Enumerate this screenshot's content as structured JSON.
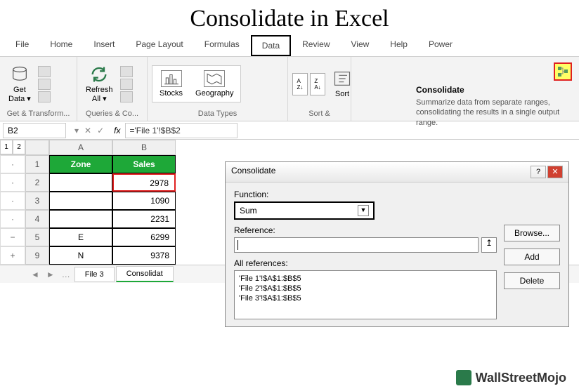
{
  "title": "Consolidate in Excel",
  "tabs": [
    "File",
    "Home",
    "Insert",
    "Page Layout",
    "Formulas",
    "Data",
    "Review",
    "View",
    "Help",
    "Power"
  ],
  "active_tab": "Data",
  "ribbon": {
    "get_data": "Get\nData ▾",
    "group1_label": "Get & Transform...",
    "refresh": "Refresh\nAll ▾",
    "group2_label": "Queries & Co...",
    "stocks": "Stocks",
    "geography": "Geography",
    "group3_label": "Data Types",
    "sort": "Sort",
    "group4_label": "Sort &"
  },
  "tooltip": {
    "title": "Consolidate",
    "body": "Summarize data from separate ranges, consolidating the results in a single output range."
  },
  "formula_bar": {
    "name_box": "B2",
    "formula": "='File 1'!$B$2"
  },
  "grid": {
    "cols": [
      "A",
      "B"
    ],
    "rows": [
      {
        "num": "1",
        "a": "Zone",
        "b": "Sales",
        "header": true
      },
      {
        "num": "2",
        "a": "",
        "b": "2978",
        "sel": true
      },
      {
        "num": "3",
        "a": "",
        "b": "1090"
      },
      {
        "num": "4",
        "a": "",
        "b": "2231"
      },
      {
        "num": "5",
        "a": "E",
        "b": "6299"
      },
      {
        "num": "9",
        "a": "N",
        "b": "9378"
      }
    ],
    "outline_levels": [
      "1",
      "2"
    ],
    "outline_marks": [
      "·",
      "·",
      "·",
      "·",
      "−",
      "+"
    ]
  },
  "sheet_tabs": {
    "inactive": "File 3",
    "active": "Consolidat"
  },
  "dialog": {
    "title": "Consolidate",
    "function_label": "Function:",
    "function_value": "Sum",
    "reference_label": "Reference:",
    "allrefs_label": "All references:",
    "refs": [
      "'File 1'!$A$1:$B$5",
      "'File 2'!$A$1:$B$5",
      "'File 3'!$A$1:$B$5"
    ],
    "browse": "Browse...",
    "add": "Add",
    "delete": "Delete"
  },
  "watermark": "WallStreetMojo"
}
